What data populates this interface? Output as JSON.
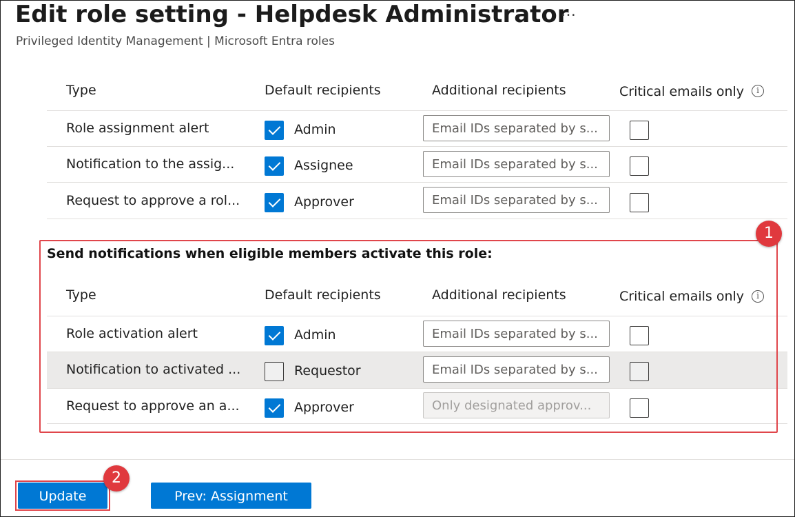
{
  "header": {
    "title": "Edit role setting - Helpdesk Administrator",
    "more_label": "…",
    "subtitle": "Privileged Identity Management | Microsoft Entra roles"
  },
  "columns": {
    "type": "Type",
    "default_recipients": "Default recipients",
    "additional_recipients": "Additional recipients",
    "critical_emails_only": "Critical emails only",
    "info_icon": "i"
  },
  "table1": {
    "rows": [
      {
        "type": "Role assignment alert",
        "recipient": "Admin",
        "recipient_checked": true,
        "placeholder": "Email IDs separated by s...",
        "input_disabled": false,
        "critical_checked": false
      },
      {
        "type": "Notification to the assig...",
        "recipient": "Assignee",
        "recipient_checked": true,
        "placeholder": "Email IDs separated by s...",
        "input_disabled": false,
        "critical_checked": false
      },
      {
        "type": "Request to approve a rol...",
        "recipient": "Approver",
        "recipient_checked": true,
        "placeholder": "Email IDs separated by s...",
        "input_disabled": false,
        "critical_checked": false
      }
    ]
  },
  "section2": {
    "title": "Send notifications when eligible members activate this role:",
    "rows": [
      {
        "type": "Role activation alert",
        "recipient": "Admin",
        "recipient_checked": true,
        "placeholder": "Email IDs separated by s...",
        "input_disabled": false,
        "critical_checked": false
      },
      {
        "type": "Notification to activated ...",
        "recipient": "Requestor",
        "recipient_checked": false,
        "placeholder": "Email IDs separated by s...",
        "input_disabled": false,
        "critical_checked": false
      },
      {
        "type": "Request to approve an a...",
        "recipient": "Approver",
        "recipient_checked": true,
        "placeholder": "Only designated approv...",
        "input_disabled": true,
        "critical_checked": false
      }
    ]
  },
  "callouts": {
    "badge1": "1",
    "badge2": "2"
  },
  "footer": {
    "update_label": "Update",
    "prev_label": "Prev: Assignment"
  },
  "colors": {
    "accent": "#0078d4",
    "callout": "#e0393e"
  }
}
